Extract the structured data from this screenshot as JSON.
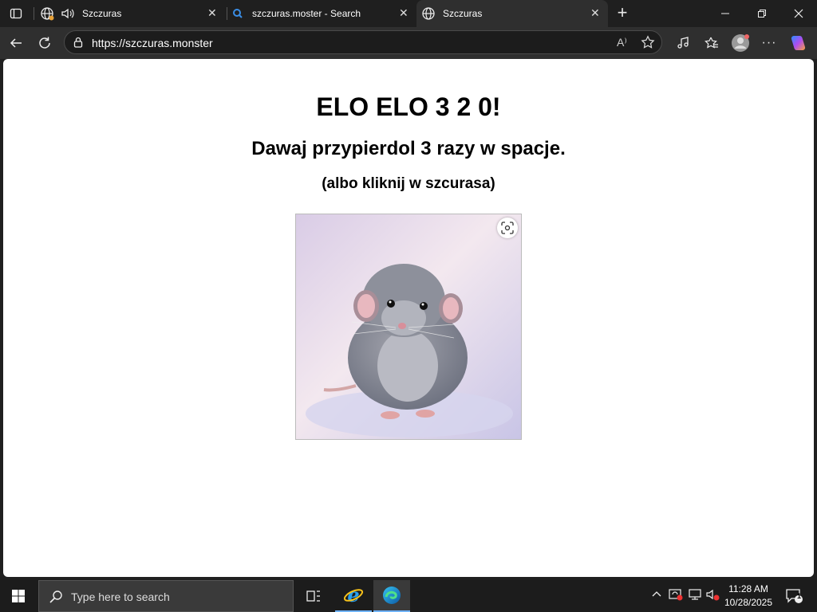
{
  "browser": {
    "tabs": [
      {
        "title": "Szczuras",
        "active": false
      },
      {
        "title": "szczuras.moster - Search",
        "active": false
      },
      {
        "title": "Szczuras",
        "active": true
      }
    ],
    "url": "https://szczuras.monster",
    "read_aloud_label": "A⁾"
  },
  "page": {
    "heading": "ELO ELO 3 2 0!",
    "subheading": "Dawaj przypierdol 3 razy w spacje.",
    "hint": "(albo kliknij w szcurasa)"
  },
  "taskbar": {
    "search_placeholder": "Type here to search",
    "time": "11:28 AM",
    "date": "10/28/2025",
    "notification_count": "1"
  },
  "colors": {
    "tabstrip": "#1f1f1f",
    "toolbar": "#2f2f2f",
    "taskbar": "#1c1c1c",
    "page_background": "#ffffff"
  }
}
